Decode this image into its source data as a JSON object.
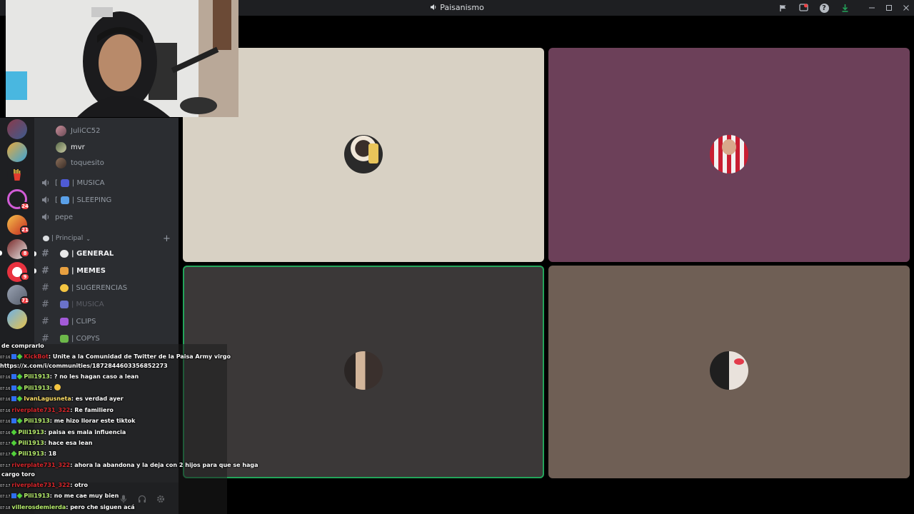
{
  "window": {
    "title": "Paisanismo",
    "colors": {
      "titlebar": "#1e1f22",
      "sidebar": "#2b2d31",
      "speaking": "#23a55a"
    }
  },
  "sidebar": {
    "voice_users": [
      {
        "name": "JuliCC52"
      },
      {
        "name": "mvr"
      },
      {
        "name": "toquesito"
      }
    ],
    "voice_channels": [
      {
        "label": "| MUSICA",
        "icon": "music-note-icon"
      },
      {
        "label": "| SLEEPING",
        "icon": "sleep-icon"
      },
      {
        "label": "pepe"
      }
    ],
    "category": "| Principal",
    "text_channels": [
      {
        "label": "| GENERAL",
        "icon": "speech-bubble-icon"
      },
      {
        "label": "| MEMES",
        "icon": "cat-icon"
      },
      {
        "label": "| SUGERENCIAS",
        "icon": "face-icon"
      },
      {
        "label": "| MUSICA",
        "icon": "music-note-icon"
      },
      {
        "label": "| CLIPS",
        "icon": "clips-icon"
      },
      {
        "label": "| COPYS",
        "icon": "copy-icon"
      }
    ],
    "server_badges": [
      "24",
      "21",
      "8",
      "9",
      "71"
    ]
  },
  "chat": {
    "lines": [
      {
        "user": "",
        "msg": "de comprarlo"
      },
      {
        "time": "07:16",
        "user": "KickBot",
        "msg": ": Unite a la Comunidad de Twitter de la Paisa Army virgo"
      },
      {
        "user": "",
        "msg": "https://x.com/i/communities/1872844603356852273"
      },
      {
        "time": "07:16",
        "user": "Pili1913",
        "msg": ": ? no les hagan caso a lean"
      },
      {
        "time": "07:16",
        "user": "Pili1913",
        "msg": ":"
      },
      {
        "time": "07:16",
        "user": "IvanLagusneta",
        "msg": ": es verdad ayer"
      },
      {
        "time": "07:16",
        "user": "riverplate731_322",
        "msg": ": Re familiero"
      },
      {
        "time": "07:16",
        "user": "Pili1913",
        "msg": ": me hizo llorar este tiktok"
      },
      {
        "time": "07:16",
        "user": "Pili1913",
        "msg": ": paisa es mala influencia"
      },
      {
        "time": "07:17",
        "user": "Pili1913",
        "msg": ": hace esa lean"
      },
      {
        "time": "07:17",
        "user": "Pili1913",
        "msg": ": 18"
      },
      {
        "time": "07:17",
        "user": "riverplate731_322",
        "msg": ": ahora la abandona y la deja con 2 hijos para que se haga"
      },
      {
        "user": "",
        "msg": "cargo toro"
      },
      {
        "time": "07:17",
        "user": "riverplate731_322",
        "msg": ": otro"
      },
      {
        "time": "07:17",
        "user": "Pili1913",
        "msg": ": no me cae muy bien"
      },
      {
        "time": "07:18",
        "user": "villerosdemierda",
        "msg": ": pero che siguen acá"
      }
    ]
  }
}
